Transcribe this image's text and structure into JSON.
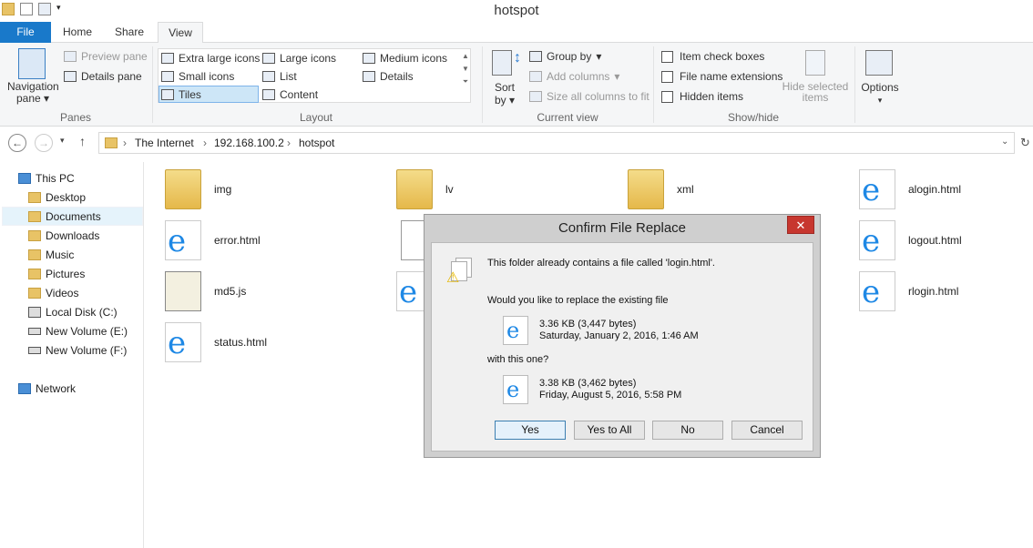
{
  "window": {
    "title": "hotspot"
  },
  "tabs": [
    {
      "label": "File"
    },
    {
      "label": "Home"
    },
    {
      "label": "Share"
    },
    {
      "label": "View"
    }
  ],
  "ribbon": {
    "panes": {
      "nav_pane": "Navigation",
      "nav_pane2": "pane",
      "preview": "Preview pane",
      "details": "Details pane",
      "label": "Panes"
    },
    "layout": {
      "items": [
        "Extra large icons",
        "Large icons",
        "Medium icons",
        "Small icons",
        "List",
        "Details",
        "Tiles",
        "Content"
      ],
      "label": "Layout"
    },
    "current_view": {
      "sort": "Sort",
      "sort2": "by",
      "group_by": "Group by",
      "add_columns": "Add columns",
      "size_columns": "Size all columns to fit",
      "label": "Current view"
    },
    "show_hide": {
      "item_checkboxes": "Item check boxes",
      "file_name_ext": "File name extensions",
      "hidden_items": "Hidden items",
      "hide_selected": "Hide selected",
      "hide_selected2": "items",
      "label": "Show/hide"
    },
    "options": {
      "label": "Options"
    }
  },
  "address": {
    "crumbs": [
      "The Internet",
      "192.168.100.2",
      "hotspot"
    ]
  },
  "nav": {
    "items": [
      "This PC",
      "Desktop",
      "Documents",
      "Downloads",
      "Music",
      "Pictures",
      "Videos",
      "Local Disk (C:)",
      "New Volume (E:)",
      "New Volume (F:)",
      "Network"
    ]
  },
  "files": [
    "img",
    "lv",
    "xml",
    "alogin.html",
    "error.html",
    "logout.html",
    "md5.js",
    "rlogin.html",
    "status.html"
  ],
  "dialog": {
    "title": "Confirm File Replace",
    "close": "✕",
    "message": "This folder already contains a file called 'login.html'.",
    "question": "Would you like to replace the existing file",
    "existing": {
      "size": "3.36 KB (3,447 bytes)",
      "date": "Saturday, January 2, 2016, 1:46 AM"
    },
    "with": "with this one?",
    "new": {
      "size": "3.38 KB (3,462 bytes)",
      "date": "Friday, August 5, 2016, 5:58 PM"
    },
    "buttons": {
      "yes": "Yes",
      "yes_all": "Yes to All",
      "no": "No",
      "cancel": "Cancel"
    }
  }
}
